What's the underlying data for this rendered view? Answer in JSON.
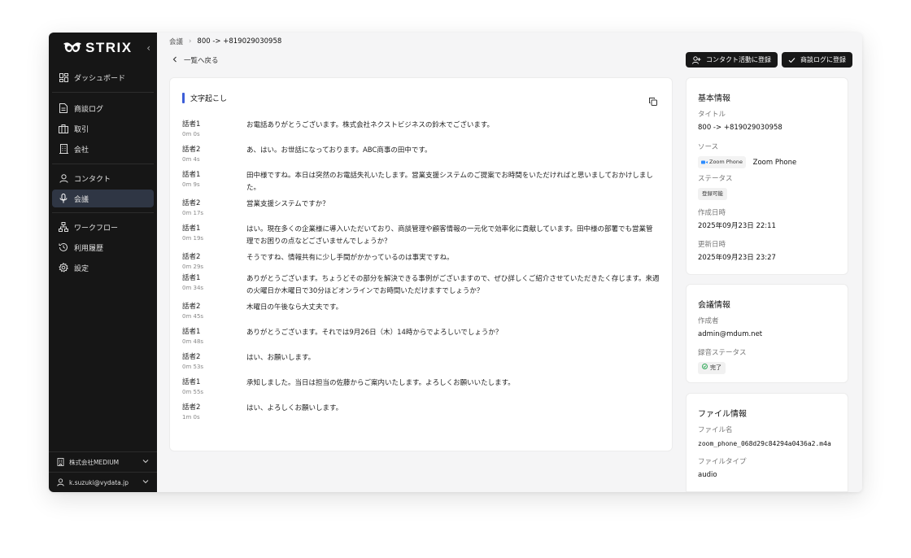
{
  "sidebar": {
    "brand": "STRIX",
    "collapse_icon": "‹",
    "items": [
      {
        "label": "ダッシュボード",
        "icon": "dashboard-icon"
      },
      {
        "label": "商談ログ",
        "icon": "document-icon"
      },
      {
        "label": "取引",
        "icon": "briefcase-icon"
      },
      {
        "label": "会社",
        "icon": "building-icon"
      },
      {
        "label": "コンタクト",
        "icon": "user-icon"
      },
      {
        "label": "会議",
        "icon": "microphone-icon"
      },
      {
        "label": "ワークフロー",
        "icon": "workflow-icon"
      },
      {
        "label": "利用履歴",
        "icon": "history-icon"
      },
      {
        "label": "設定",
        "icon": "gear-icon"
      }
    ],
    "active_item": "会議",
    "org": "株式会社MEDIUM",
    "user": "k.suzuki@vydata.jp"
  },
  "header": {
    "breadcrumb_parent": "会議",
    "breadcrumb_sep": "›",
    "breadcrumb_current": "800 -> +819029030958",
    "back_label": "一覧へ戻る",
    "btn_contact": "コンタクト活動に登録",
    "btn_log": "商談ログに登録"
  },
  "transcript": {
    "title": "文字起こし",
    "rows": [
      {
        "speaker": "話者1",
        "time": "0m 0s",
        "text": "お電話ありがとうございます。株式会社ネクストビジネスの鈴木でございます。"
      },
      {
        "speaker": "話者2",
        "time": "0m 4s",
        "text": "あ、はい。お世話になっております。ABC商事の田中です。"
      },
      {
        "speaker": "話者1",
        "time": "0m 9s",
        "text": "田中様ですね。本日は突然のお電話失礼いたします。営業支援システムのご提案でお時間をいただければと思いましておかけしました。"
      },
      {
        "speaker": "話者2",
        "time": "0m 17s",
        "text": "営業支援システムですか？"
      },
      {
        "speaker": "話者1",
        "time": "0m 19s",
        "text": "はい。現在多くの企業様に導入いただいており、商談管理や顧客情報の一元化で効率化に貢献しています。田中様の部署でも営業管理でお困りの点などございませんでしょうか？"
      },
      {
        "speaker": "話者2",
        "time": "0m 29s",
        "text": "そうですね、情報共有に少し手間がかかっているのは事実ですね。"
      },
      {
        "speaker": "話者1",
        "time": "0m 34s",
        "text": "ありがとうございます。ちょうどその部分を解決できる事例がございますので、ぜひ詳しくご紹介させていただきたく存じます。来週の火曜日か木曜日で30分ほどオンラインでお時間いただけますでしょうか？"
      },
      {
        "speaker": "話者2",
        "time": "0m 45s",
        "text": "木曜日の午後なら大丈夫です。"
      },
      {
        "speaker": "話者1",
        "time": "0m 48s",
        "text": "ありがとうございます。それでは9月26日（木）14時からでよろしいでしょうか？"
      },
      {
        "speaker": "話者2",
        "time": "0m 53s",
        "text": "はい、お願いします。"
      },
      {
        "speaker": "話者1",
        "time": "0m 55s",
        "text": "承知しました。当日は担当の佐藤からご案内いたします。よろしくお願いいたします。"
      },
      {
        "speaker": "話者2",
        "time": "1m 0s",
        "text": "はい、よろしくお願いします。"
      }
    ]
  },
  "basic_info": {
    "heading": "基本情報",
    "title_label": "タイトル",
    "title_value": "800 -> +819029030958",
    "source_label": "ソース",
    "source_chip": "Zoom Phone",
    "source_value": "Zoom Phone",
    "status_label": "ステータス",
    "status_value": "登録可能",
    "created_label": "作成日時",
    "created_value": "2025年09月23日 22:11",
    "updated_label": "更新日時",
    "updated_value": "2025年09月23日 23:27"
  },
  "meeting_info": {
    "heading": "会議情報",
    "creator_label": "作成者",
    "creator_value": "admin@mdum.net",
    "rec_label": "録音ステータス",
    "rec_value": "完了"
  },
  "file_info": {
    "heading": "ファイル情報",
    "name_label": "ファイル名",
    "name_value": "zoom_phone_068d29c84294a0436a2.m4a",
    "type_label": "ファイルタイプ",
    "type_value": "audio"
  },
  "colors": {
    "sidebar_bg": "#161616",
    "active_bg": "#2f3644",
    "accent_bar": "#3d5ed8",
    "button_bg": "#181818",
    "success": "#2aa855"
  }
}
